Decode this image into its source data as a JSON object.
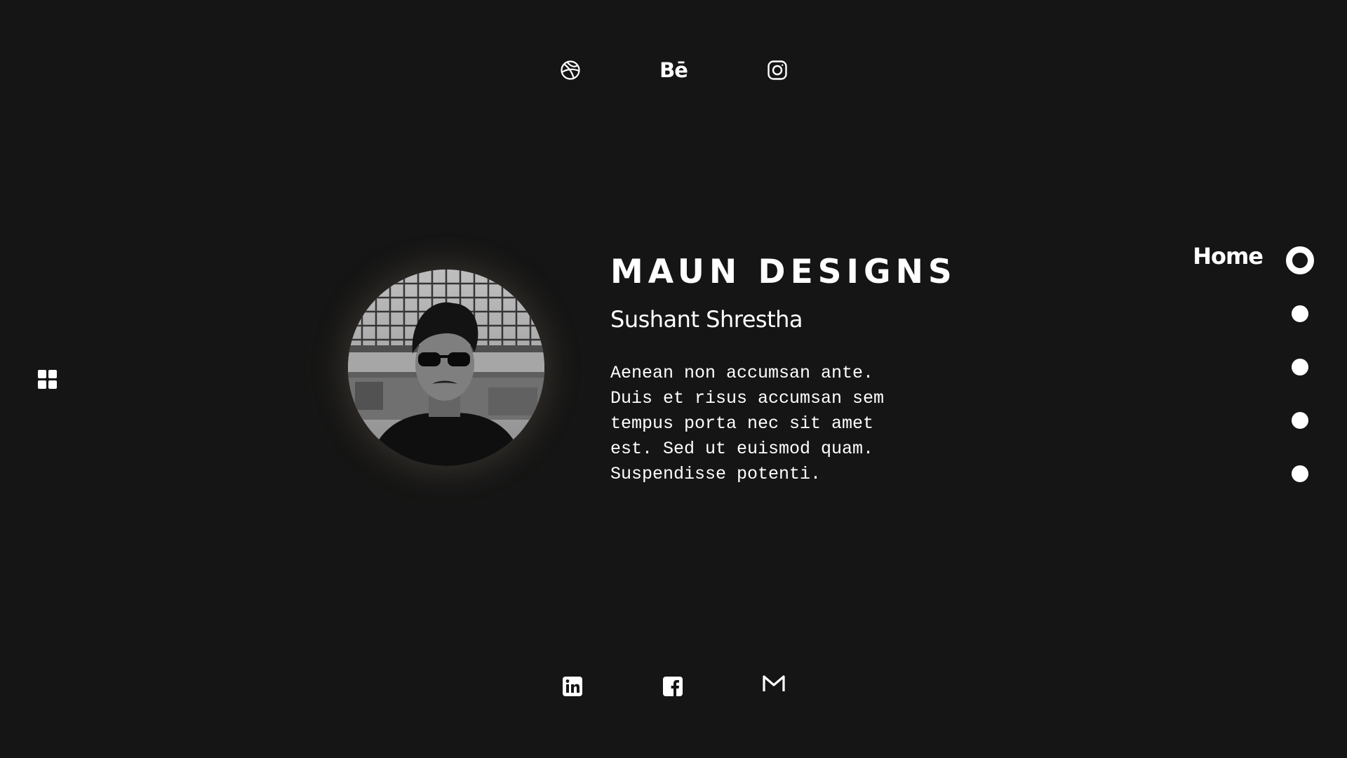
{
  "social_top": {
    "dribbble": {
      "icon": "dribbble-icon"
    },
    "behance": {
      "icon": "behance-icon",
      "text": "Bē"
    },
    "instagram": {
      "icon": "instagram-icon"
    }
  },
  "social_bottom": {
    "linkedin": {
      "icon": "linkedin-icon"
    },
    "facebook": {
      "icon": "facebook-icon"
    },
    "gmail": {
      "icon": "gmail-icon"
    }
  },
  "menu": {
    "icon": "grid-menu-icon"
  },
  "hero": {
    "brand": "MAUN DESIGNS",
    "name": "Sushant Shrestha",
    "bio": "Aenean non accumsan ante.\nDuis et risus accumsan sem\ntempus porta nec sit amet\nest. Sed ut euismod quam.\nSuspendisse potenti."
  },
  "side_nav": {
    "items": [
      {
        "label": "Home",
        "active": true
      },
      {
        "label": "",
        "active": false
      },
      {
        "label": "",
        "active": false
      },
      {
        "label": "",
        "active": false
      },
      {
        "label": "",
        "active": false
      }
    ]
  },
  "colors": {
    "background": "#151515",
    "foreground": "#ffffff"
  }
}
